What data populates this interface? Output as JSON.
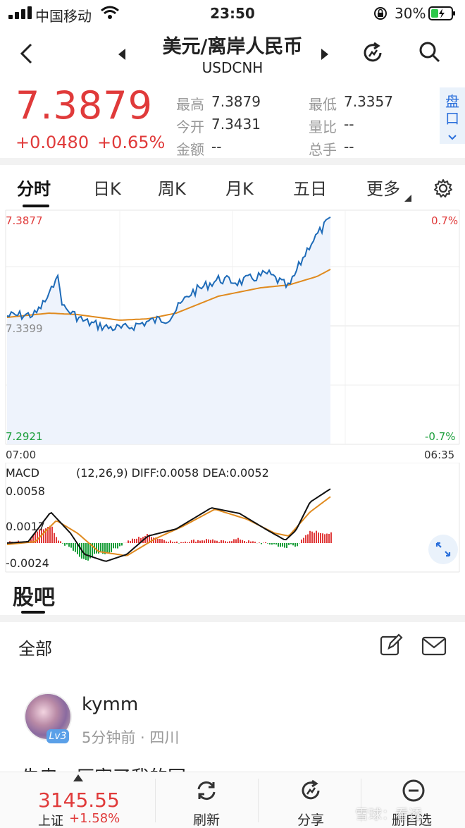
{
  "status_bar": {
    "carrier": "中国移动",
    "time": "23:50",
    "battery": "30%"
  },
  "header": {
    "title": "美元/离岸人民币",
    "subtitle": "USDCNH"
  },
  "quote": {
    "price": "7.3879",
    "change": "+0.0480",
    "change_pct": "+0.65%",
    "high_label": "最高",
    "high": "7.3879",
    "low_label": "最低",
    "low": "7.3357",
    "open_label": "今开",
    "open": "7.3431",
    "ratio_label": "量比",
    "ratio": "--",
    "amount_label": "金额",
    "amount": "--",
    "hands_label": "总手",
    "hands": "--",
    "pankou": "盘口"
  },
  "tabs": [
    "分时",
    "日K",
    "周K",
    "月K",
    "五日",
    "更多"
  ],
  "chart": {
    "y_top": "7.3877",
    "y_mid": "7.3399",
    "y_bot": "7.2921",
    "pct_top": "0.7%",
    "pct_bot": "-0.7%",
    "x_start": "07:00",
    "x_end": "06:35"
  },
  "macd": {
    "title": "MACD",
    "params": "(12,26,9) DIFF:0.0058 DEA:0.0052",
    "y_top": "0.0058",
    "y_mid": "0.0017",
    "y_bot": "-0.0024"
  },
  "community": {
    "title": "股吧",
    "filter": "全部",
    "post": {
      "username": "kymm",
      "level": "Lv3",
      "meta": "5分钟前 · 四川",
      "snippet": "先忠一厉害了我的国"
    }
  },
  "bottom_bar": {
    "index_value": "3145.55",
    "index_name": "上证",
    "index_change": "+1.58%",
    "refresh": "刷新",
    "share": "分享",
    "remove_fav": "删自选",
    "watermark": "雪球：看透"
  },
  "colors": {
    "up": "#e03a3a",
    "down": "#1a9e3a",
    "line": "#1e6bb8",
    "avg": "#e08a1e",
    "accent": "#2a6fdb"
  }
}
